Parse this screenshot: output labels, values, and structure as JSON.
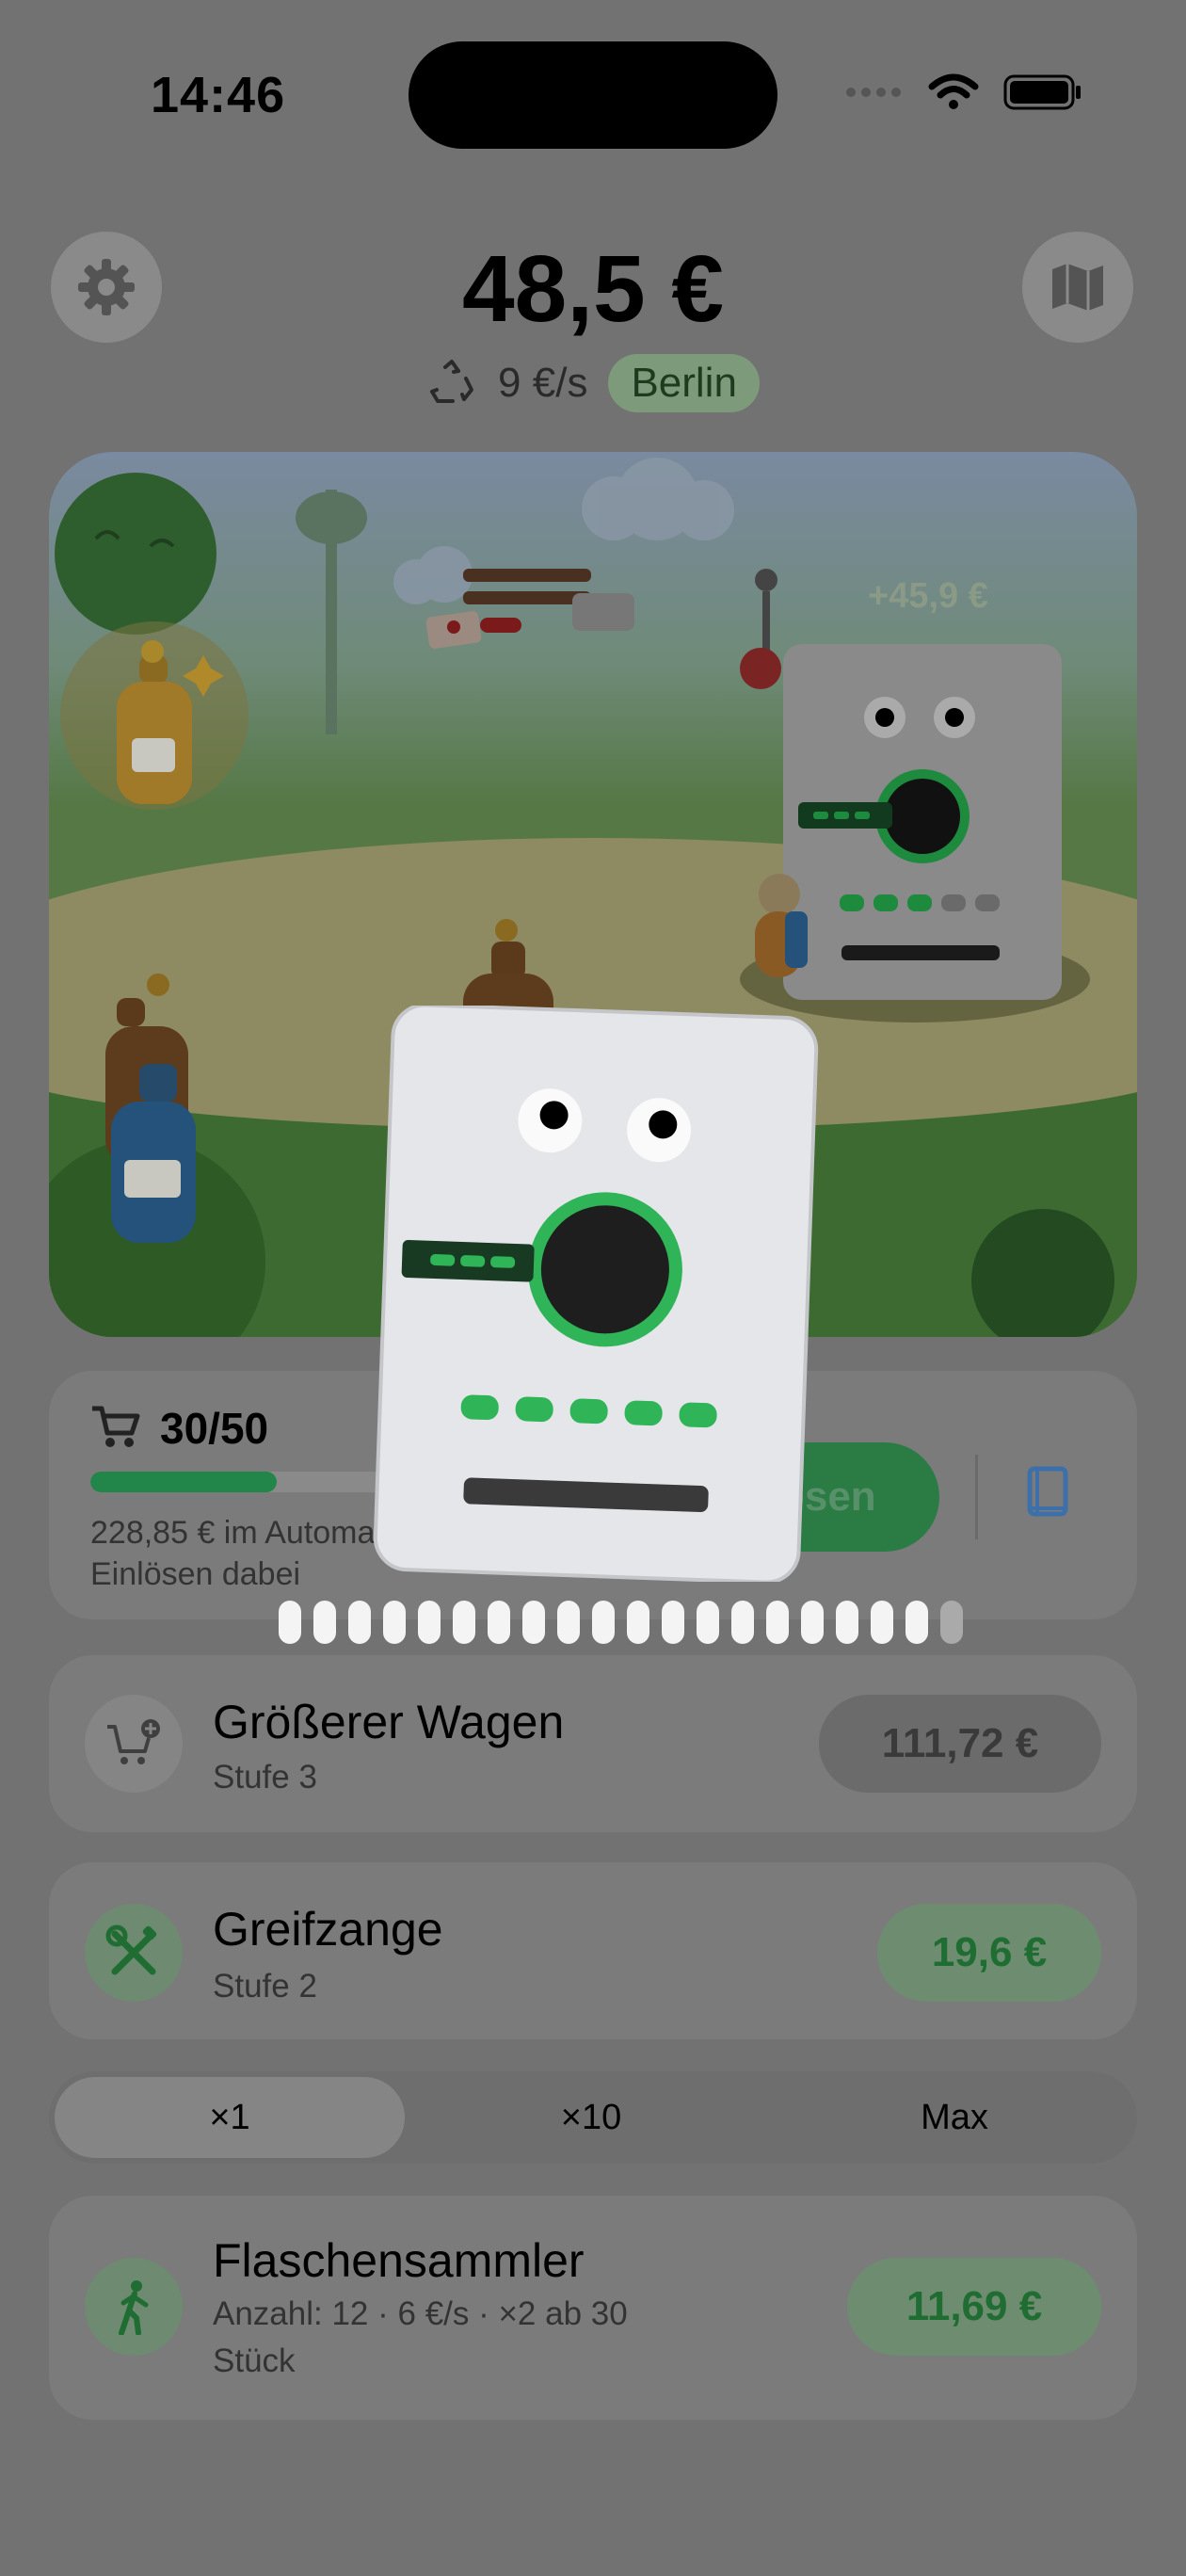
{
  "status_bar": {
    "time": "14:46"
  },
  "header": {
    "balance": "48,5 €",
    "rate": "9 €/s",
    "city": "Berlin"
  },
  "scene": {
    "floating_gain": "+45,9 €"
  },
  "cart": {
    "count": "30/50",
    "progress": 0.6,
    "note": "228,85 € im Automaten — beim Einlösen dabei",
    "redeem_label": "Einlösen"
  },
  "upgrades": [
    {
      "title": "Größerer Wagen",
      "subtitle": "Stufe 3",
      "price": "111,72 €",
      "icon": "cart-plus-icon",
      "affordable": false
    },
    {
      "title": "Greifzange",
      "subtitle": "Stufe 2",
      "price": "19,6 €",
      "icon": "tools-icon",
      "affordable": true
    }
  ],
  "multiplier": {
    "options": [
      "×1",
      "×10",
      "Max"
    ],
    "selected": "×1"
  },
  "collectors": [
    {
      "title": "Flaschensammler",
      "subtitle_line1": "Anzahl: 12 · 6 €/s · ×2 ab 30",
      "subtitle_line2": "Stück",
      "price": "11,69 €",
      "icon": "walking-person-icon"
    }
  ],
  "colors": {
    "accent_green": "#22c55e",
    "button_green": "#2a7c44",
    "overlay_gray": "#727272"
  },
  "machine_progress": {
    "filled": 19,
    "total": 20
  }
}
